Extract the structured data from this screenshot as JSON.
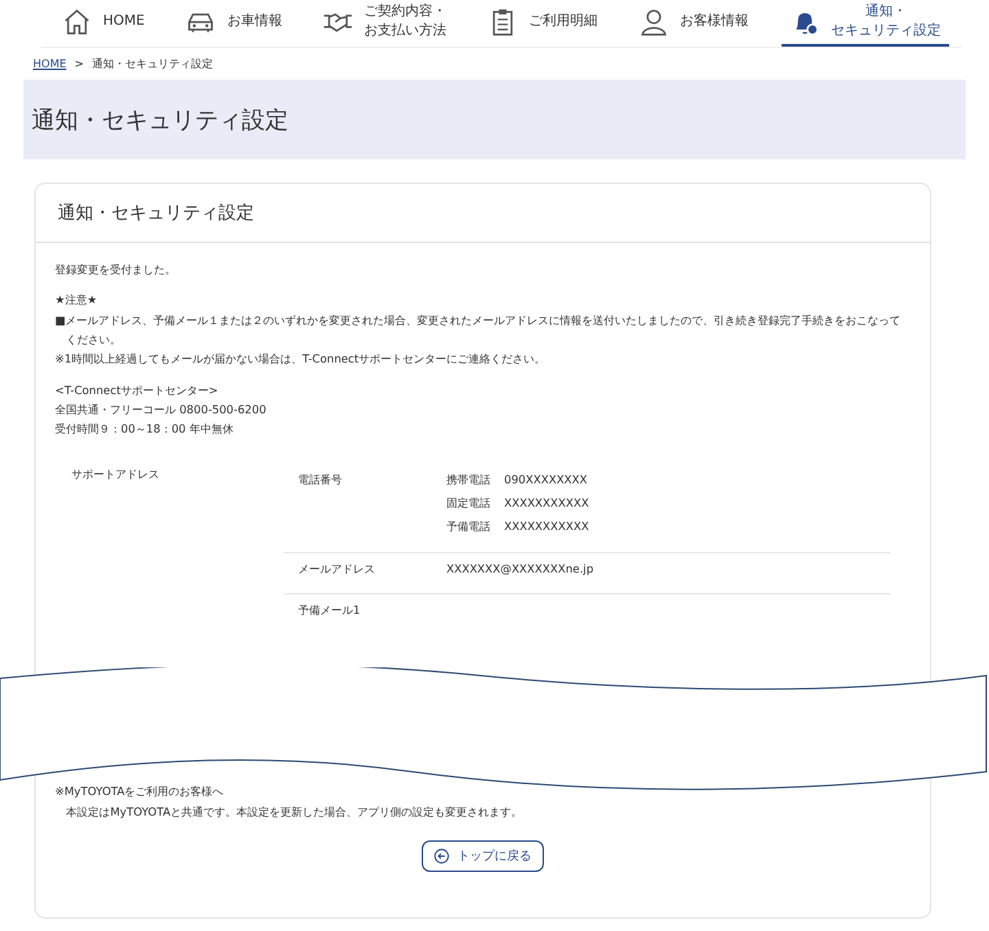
{
  "nav": [
    {
      "kind": "home",
      "lines": [
        "HOME"
      ],
      "selected": false
    },
    {
      "kind": "car",
      "lines": [
        "お車情報"
      ],
      "selected": false
    },
    {
      "kind": "handshake",
      "lines": [
        "ご契約内容・",
        "お支払い方法"
      ],
      "selected": false
    },
    {
      "kind": "clipboard",
      "lines": [
        "ご利用明細"
      ],
      "selected": false
    },
    {
      "kind": "person",
      "lines": [
        "お客様情報"
      ],
      "selected": false
    },
    {
      "kind": "bell",
      "lines": [
        "通知・",
        "セキュリティ設定"
      ],
      "selected": true
    }
  ],
  "breadcrumb": {
    "link": "HOME",
    "separator": ">",
    "current": "通知・セキュリティ設定"
  },
  "page_title": "通知・セキュリティ設定",
  "card": {
    "title": "通知・セキュリティ設定",
    "message": "登録変更を受付ました。",
    "notice_heading": "★注意★",
    "notice_lines": [
      "■メールアドレス、予備メール１または２のいずれかを変更された場合、変更されたメールアドレスに情報を送付いたしましたので、引き続き登録完了手続きをおこなってください。",
      "※1時間以上経過してもメールが届かない場合は、T-Connectサポートセンターにご連絡ください。"
    ],
    "support_lines": [
      "<T-Connectサポートセンター>",
      "全国共通・フリーコール 0800-500-6200",
      "受付時間９：00～18：00 年中無休"
    ],
    "address_section": {
      "label": "サポートアドレス",
      "groups": [
        {
          "label": "電話番号",
          "items": [
            {
              "label": "携帯電話",
              "value": "090XXXXXXXX"
            },
            {
              "label": "固定電話",
              "value": "XXXXXXXXXXX"
            },
            {
              "label": "予備電話",
              "value": "XXXXXXXXXXX"
            }
          ]
        },
        {
          "label": "メールアドレス",
          "items": [
            {
              "value": "XXXXXXX@XXXXXXXne.jp"
            }
          ]
        },
        {
          "label": "予備メール1"
        }
      ]
    },
    "footer_notes": [
      "※MyTOYOTAをご利用のお客様へ",
      "本設定はMyTOYOTAと共通です。本設定を更新した場合、アプリ側の設定も変更されます。"
    ],
    "back_button": "トップに戻る"
  }
}
